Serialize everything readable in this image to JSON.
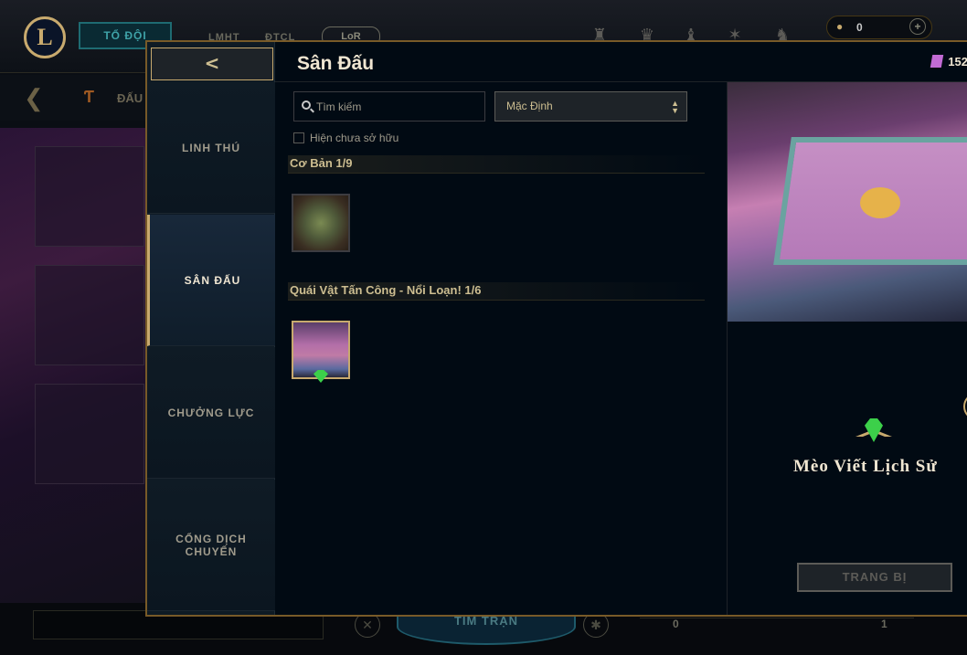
{
  "bg": {
    "party_label": "TỔ ĐỘI",
    "nav": [
      "LMHT",
      "ĐTCL"
    ],
    "lor_label": "LoR",
    "currency_value": "0",
    "tft_label": "ĐẤU",
    "find_match_label": "TÌM TRẬN",
    "slider_min": "0",
    "slider_max": "1"
  },
  "modal": {
    "back_glyph": "<",
    "title": "Sân Đấu",
    "rp_amount": "152",
    "sidebar": [
      "LINH THÚ",
      "SÂN ĐẤU",
      "CHƯỞNG LỰC",
      "CỔNG DỊCH CHUYỂN"
    ],
    "search_placeholder": "Tìm kiếm",
    "sort_value": "Mặc Định",
    "owned_label": "Hiện chưa sở hữu",
    "sections": [
      {
        "title": "Cơ Bản 1/9"
      },
      {
        "title": "Quái Vật Tấn Công - Nổi Loạn! 1/6"
      }
    ],
    "preview_name": "Mèo Viết Lịch Sử",
    "equip_label": "TRANG BỊ"
  },
  "colors": {
    "gold": "#c8aa6e",
    "bg": "#010a13",
    "gem": "#3cd04a"
  }
}
